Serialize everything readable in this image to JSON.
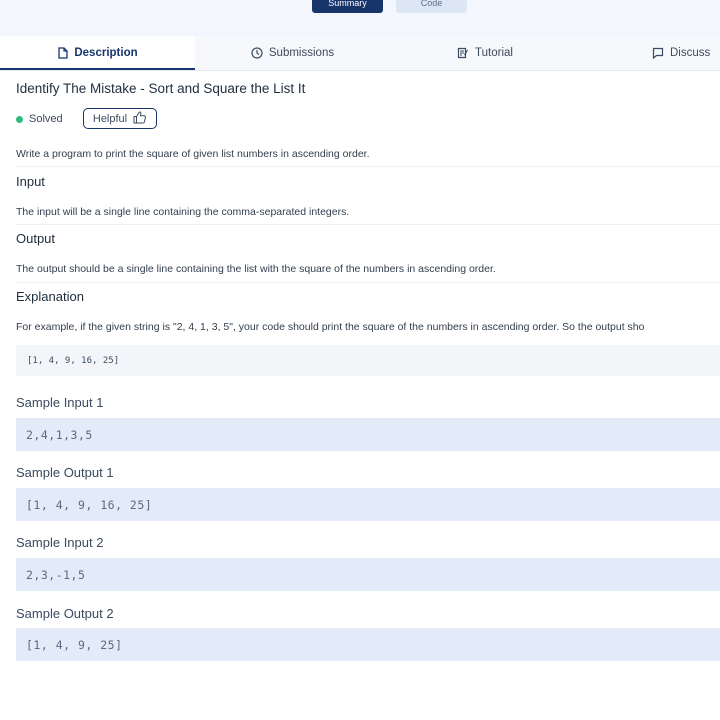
{
  "top_toggle": {
    "summary_label": "Summary",
    "code_label": "Code"
  },
  "tabs": [
    {
      "label": "Description",
      "icon": "document-icon",
      "active": true
    },
    {
      "label": "Submissions",
      "icon": "clock-icon",
      "active": false
    },
    {
      "label": "Tutorial",
      "icon": "tutorial-icon",
      "active": false
    },
    {
      "label": "Discuss",
      "icon": "chat-icon",
      "active": false
    }
  ],
  "problem": {
    "title": "Identify The Mistake - Sort and Square the List It",
    "status": "Solved",
    "helpful_label": "Helpful",
    "description": "Write a program to print the square of given list numbers in ascending order.",
    "input_heading": "Input",
    "input_text": "The input will be a single line containing the comma-separated integers.",
    "output_heading": "Output",
    "output_text": "The output should be a single line containing the list with the square of the numbers in ascending order.",
    "explanation_heading": "Explanation",
    "explanation_text": "For example, if the given string is \"2, 4, 1, 3, 5\", your code should print the square of the numbers in ascending order. So the output sho",
    "explanation_code": "[1, 4, 9, 16, 25]"
  },
  "samples": [
    {
      "label": "Sample Input 1",
      "value": "2,4,1,3,5"
    },
    {
      "label": "Sample Output 1",
      "value": "[1, 4, 9, 16, 25]"
    },
    {
      "label": "Sample Input 2",
      "value": "2,3,-1,5"
    },
    {
      "label": "Sample Output 2",
      "value": "[1, 4, 9, 25]"
    }
  ],
  "colors": {
    "primary": "#17356a",
    "solved_dot": "#2dbb7f",
    "sample_bg": "#e3ebf8"
  }
}
